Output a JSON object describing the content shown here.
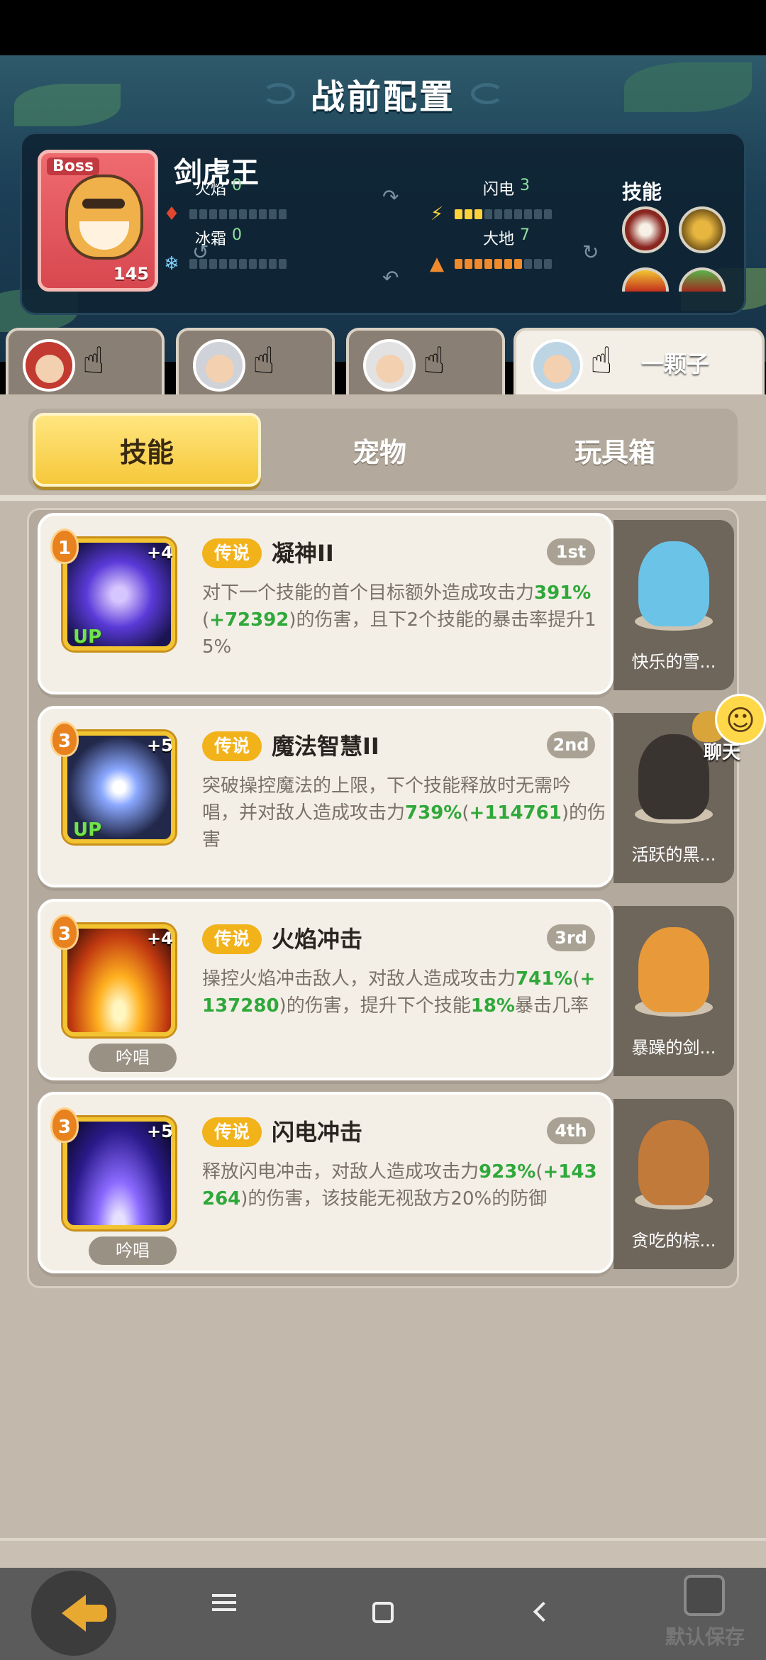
{
  "title": "战前配置",
  "boss": {
    "badge": "Boss",
    "name": "剑虎王",
    "level": "145",
    "skills_label": "技能",
    "elements": [
      {
        "name": "火焰",
        "value": "0",
        "filled": 0,
        "icon": "fire-icon"
      },
      {
        "name": "闪电",
        "value": "3",
        "filled": 3,
        "icon": "lightning-icon"
      },
      {
        "name": "冰霜",
        "value": "0",
        "filled": 0,
        "icon": "frost-icon"
      },
      {
        "name": "大地",
        "value": "7",
        "filled": 7,
        "icon": "earth-icon"
      }
    ]
  },
  "hero_tabs": [
    {
      "label": "",
      "active": false
    },
    {
      "label": "",
      "active": false
    },
    {
      "label": "",
      "active": false
    },
    {
      "label": "一颗子",
      "active": true
    }
  ],
  "segments": {
    "skills": "技能",
    "pets": "宠物",
    "toys": "玩具箱",
    "active": "技能"
  },
  "cards": [
    {
      "level": "1",
      "plus": "+4",
      "up": "UP",
      "chant": "",
      "rarity": "传说",
      "name": "凝神II",
      "order": "1st",
      "desc": [
        {
          "t": "对下一个技能的首个目标额外造成攻击力"
        },
        {
          "t": "391%",
          "g": true
        },
        {
          "t": "("
        },
        {
          "t": "+72392",
          "g": true
        },
        {
          "t": ")的伤害，且下2个技能的暴击率提升15%"
        }
      ],
      "pet": "快乐的雪..."
    },
    {
      "level": "3",
      "plus": "+5",
      "up": "UP",
      "chant": "",
      "rarity": "传说",
      "name": "魔法智慧II",
      "order": "2nd",
      "desc": [
        {
          "t": "突破操控魔法的上限，下个技能释放时无需吟唱，并对敌人造成攻击力"
        },
        {
          "t": "739%",
          "g": true
        },
        {
          "t": "("
        },
        {
          "t": "+114761",
          "g": true
        },
        {
          "t": ")的伤害"
        }
      ],
      "pet": "活跃的黑..."
    },
    {
      "level": "3",
      "plus": "+4",
      "up": "",
      "chant": "吟唱",
      "rarity": "传说",
      "name": "火焰冲击",
      "order": "3rd",
      "desc": [
        {
          "t": "操控火焰冲击敌人，对敌人造成攻击力"
        },
        {
          "t": "741%",
          "g": true
        },
        {
          "t": "("
        },
        {
          "t": "+137280",
          "g": true
        },
        {
          "t": ")的伤害，提升下个技能"
        },
        {
          "t": "18%",
          "g": true
        },
        {
          "t": "暴击几率"
        }
      ],
      "pet": "暴躁的剑..."
    },
    {
      "level": "3",
      "plus": "+5",
      "up": "",
      "chant": "吟唱",
      "rarity": "传说",
      "name": "闪电冲击",
      "order": "4th",
      "desc": [
        {
          "t": "释放闪电冲击，对敌人造成攻击力"
        },
        {
          "t": "923%",
          "g": true
        },
        {
          "t": "("
        },
        {
          "t": "+143264",
          "g": true
        },
        {
          "t": ")的伤害，该技能无视敌方20%的防御"
        }
      ],
      "pet": "贪吃的棕..."
    }
  ],
  "chat_label": "聊天",
  "save_label": "默认保存",
  "colors": {
    "accent": "#f6c83a",
    "green": "#2fa83a",
    "rarity": "#f2b21a"
  }
}
